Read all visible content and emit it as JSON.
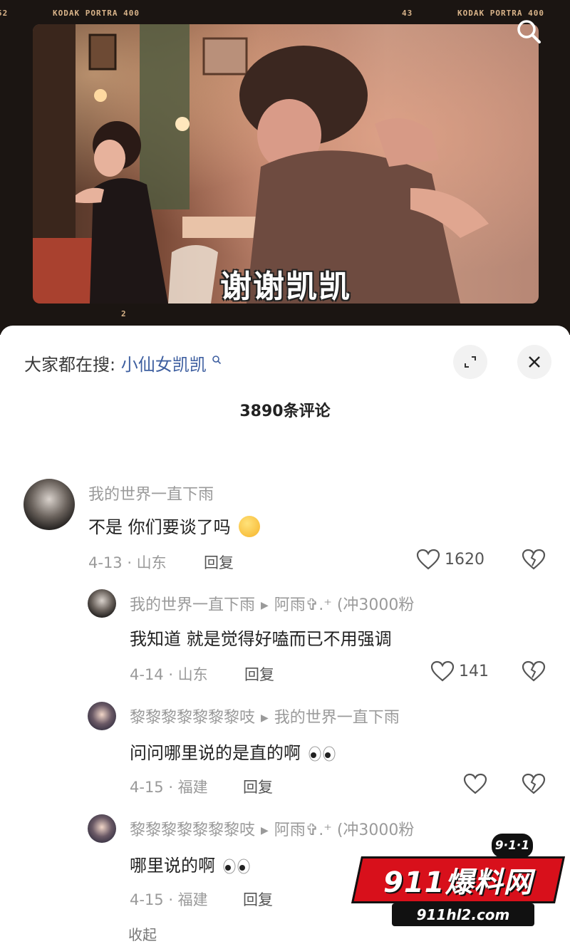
{
  "video": {
    "film_labels": [
      "KODAK PORTRA 400",
      "KODAK PORTRA 400"
    ],
    "frame_numbers": [
      "52",
      "43",
      "2"
    ],
    "subtitle": "谢谢凯凯"
  },
  "panel": {
    "search_prefix": "大家都在搜:",
    "search_term": "小仙女凯凯",
    "comment_count_title": "3890条评论"
  },
  "comments": [
    {
      "author": "我的世界一直下雨",
      "reply_to": "",
      "text": "不是 你们要谈了吗",
      "date_loc": "4-13 · 山东",
      "reply_label": "回复",
      "likes": "1620"
    },
    {
      "author": "我的世界一直下雨",
      "reply_to": "阿雨✞.⁺ (冲3000粉",
      "text": "我知道 就是觉得好嗑而已不用强调",
      "date_loc": "4-14 · 山东",
      "reply_label": "回复",
      "likes": "141"
    },
    {
      "author": "黎黎黎黎黎黎黎吱",
      "reply_to": "我的世界一直下雨",
      "text": "问问哪里说的是直的啊",
      "date_loc": "4-15 · 福建",
      "reply_label": "回复",
      "likes": ""
    },
    {
      "author": "黎黎黎黎黎黎黎吱",
      "reply_to": "阿雨✞.⁺ (冲3000粉",
      "text": "哪里说的啊",
      "date_loc": "4-15 · 福建",
      "reply_label": "回复",
      "likes": ""
    }
  ],
  "cut_off_text": "收起",
  "watermark": {
    "badge": "9·1·1",
    "brand": "911爆料网",
    "url": "911hl2.com"
  },
  "colors": {
    "link": "#3e5fa0",
    "muted": "#9a9a9a",
    "watermark_red": "#d8101b"
  }
}
